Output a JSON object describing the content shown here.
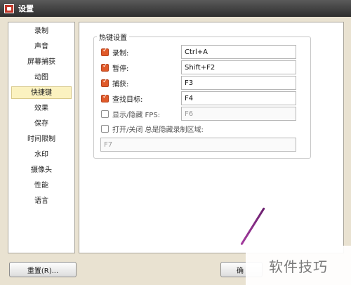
{
  "window": {
    "title": "设置"
  },
  "sidebar": {
    "items": [
      {
        "label": "录制"
      },
      {
        "label": "声音"
      },
      {
        "label": "屏幕捕获"
      },
      {
        "label": "动图"
      },
      {
        "label": "快捷键",
        "active": true
      },
      {
        "label": "效果"
      },
      {
        "label": "保存"
      },
      {
        "label": "时间限制"
      },
      {
        "label": "水印"
      },
      {
        "label": "摄像头"
      },
      {
        "label": "性能"
      },
      {
        "label": "语言"
      }
    ]
  },
  "hotkeys": {
    "group_title": "热键设置",
    "rows": [
      {
        "label": "录制:",
        "checked": true,
        "value": "Ctrl+A"
      },
      {
        "label": "暂停:",
        "checked": true,
        "value": "Shift+F2"
      },
      {
        "label": "捕获:",
        "checked": true,
        "value": "F3"
      },
      {
        "label": "查找目标:",
        "checked": true,
        "value": "F4"
      },
      {
        "label": "显示/隐藏 FPS:",
        "checked": false,
        "value": "F6"
      },
      {
        "label": "打开/关闭 总是隐藏录制区域:",
        "checked": false,
        "value": "F7"
      }
    ]
  },
  "footer": {
    "reset_label": "重置(R)...",
    "ok_label": "确"
  },
  "watermark": {
    "text": "软件技巧"
  }
}
